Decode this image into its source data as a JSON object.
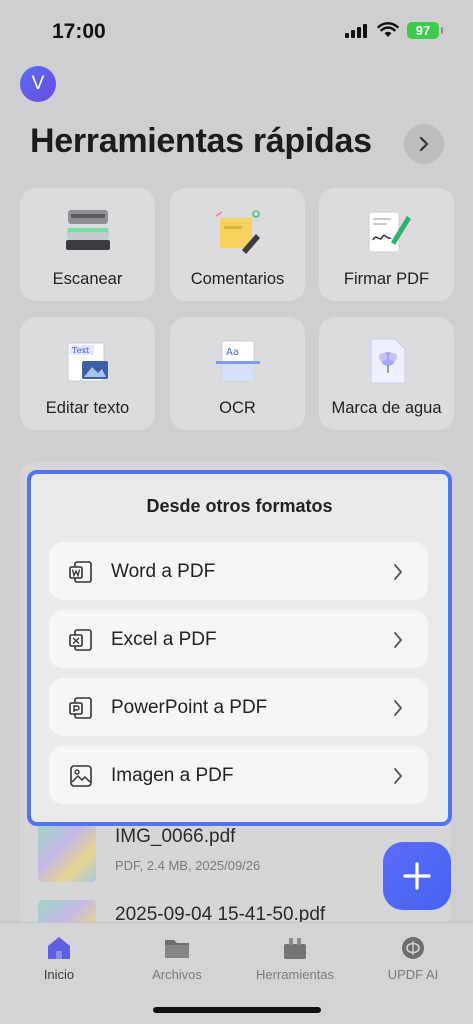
{
  "status": {
    "time": "17:00",
    "battery": "97"
  },
  "profile": {
    "initial": "V"
  },
  "header": {
    "title": "Herramientas rápidas"
  },
  "tools": [
    {
      "label": "Escanear",
      "icon": "scanner-icon"
    },
    {
      "label": "Comentarios",
      "icon": "sticky-note-icon"
    },
    {
      "label": "Firmar PDF",
      "icon": "signature-icon"
    },
    {
      "label": "Editar texto",
      "icon": "edit-text-icon"
    },
    {
      "label": "OCR",
      "icon": "ocr-icon"
    },
    {
      "label": "Marca de agua",
      "icon": "watermark-icon"
    }
  ],
  "files": [
    {
      "name": "IMG_0066.pdf",
      "meta": "PDF, 2.4 MB, 2025/09/26"
    },
    {
      "name": "2025-09-04 15-41-50.pdf"
    }
  ],
  "sheet": {
    "title": "Desde otros formatos",
    "options": [
      {
        "label": "Word a PDF",
        "icon": "word-icon"
      },
      {
        "label": "Excel a PDF",
        "icon": "excel-icon"
      },
      {
        "label": "PowerPoint a PDF",
        "icon": "powerpoint-icon"
      },
      {
        "label": "Imagen a PDF",
        "icon": "image-icon"
      }
    ]
  },
  "nav": [
    {
      "label": "Inicio",
      "icon": "home-icon",
      "active": true
    },
    {
      "label": "Archivos",
      "icon": "folder-icon"
    },
    {
      "label": "Herramientas",
      "icon": "toolbox-icon"
    },
    {
      "label": "UPDF AI",
      "icon": "ai-icon"
    }
  ],
  "colors": {
    "accent": "#4f74f4",
    "fab": "#4f66f5",
    "battery": "#3ccb4a"
  }
}
